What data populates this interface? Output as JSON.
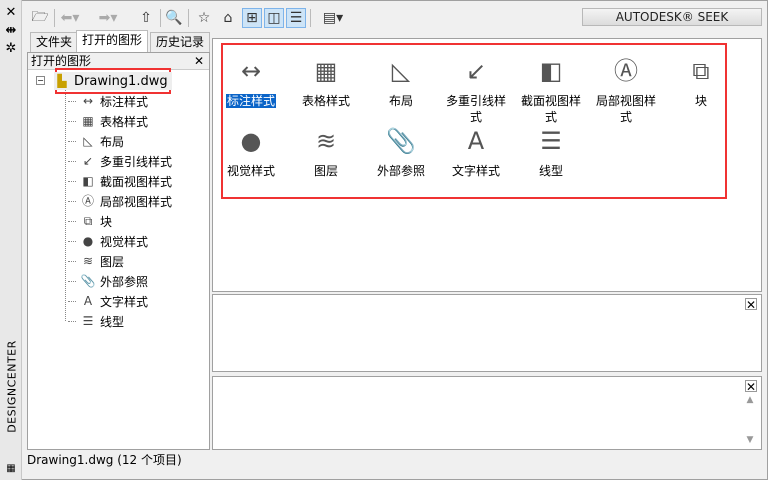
{
  "side_strip": {
    "title": "DESIGNCENTER",
    "icons": [
      "close-icon",
      "autohide-icon",
      "properties-icon"
    ]
  },
  "toolbar": {
    "buttons": [
      "load",
      "back",
      "forward",
      "up",
      "search",
      "favorites",
      "home",
      "tree-view-toggle",
      "preview",
      "description",
      "views"
    ],
    "seek_label": "AUTODESK® SEEK"
  },
  "tabs": [
    {
      "label": "文件夹",
      "active": false
    },
    {
      "label": "打开的图形",
      "active": true
    },
    {
      "label": "历史记录",
      "active": false
    }
  ],
  "tree": {
    "header": "打开的图形",
    "root": "Drawing1.dwg",
    "items": [
      "标注样式",
      "表格样式",
      "布局",
      "多重引线样式",
      "截面视图样式",
      "局部视图样式",
      "块",
      "视觉样式",
      "图层",
      "外部参照",
      "文字样式",
      "线型"
    ]
  },
  "content": {
    "items": [
      {
        "label": "标注样式",
        "icon": "dimstyle-icon",
        "selected": true
      },
      {
        "label": "表格样式",
        "icon": "tablestyle-icon"
      },
      {
        "label": "布局",
        "icon": "layout-icon"
      },
      {
        "label": "多重引线样式",
        "icon": "mleaderstyle-icon"
      },
      {
        "label": "截面视图样式",
        "icon": "sectionview-icon"
      },
      {
        "label": "局部视图样式",
        "icon": "detailview-icon"
      },
      {
        "label": "块",
        "icon": "block-icon"
      },
      {
        "label": "视觉样式",
        "icon": "visualstyle-icon"
      },
      {
        "label": "图层",
        "icon": "layer-icon"
      },
      {
        "label": "外部参照",
        "icon": "xref-icon"
      },
      {
        "label": "文字样式",
        "icon": "textstyle-icon"
      },
      {
        "label": "线型",
        "icon": "linetype-icon"
      }
    ]
  },
  "status": "Drawing1.dwg (12 个项目)",
  "colors": {
    "selection": "#0a64c8",
    "annotation": "#f03232"
  }
}
